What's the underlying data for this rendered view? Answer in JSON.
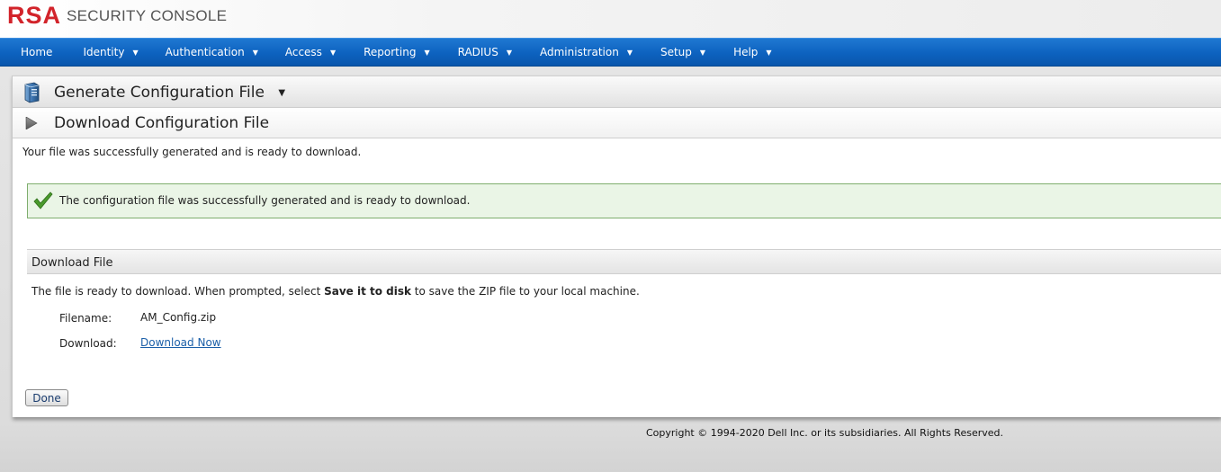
{
  "header": {
    "logo_mark": "RSA",
    "logo_text": "SECURITY CONSOLE"
  },
  "nav": {
    "items": [
      {
        "label": "Home",
        "has_menu": false
      },
      {
        "label": "Identity",
        "has_menu": true
      },
      {
        "label": "Authentication",
        "has_menu": true
      },
      {
        "label": "Access",
        "has_menu": true
      },
      {
        "label": "Reporting",
        "has_menu": true
      },
      {
        "label": "RADIUS",
        "has_menu": true
      },
      {
        "label": "Administration",
        "has_menu": true
      },
      {
        "label": "Setup",
        "has_menu": true
      },
      {
        "label": "Help",
        "has_menu": true
      }
    ],
    "caret": "▼"
  },
  "page": {
    "title": "Generate Configuration File",
    "title_icon": "server-icon",
    "subtitle": "Download Configuration File",
    "subtitle_icon": "play-arrow-icon",
    "intro": "Your file was successfully generated and is ready to download."
  },
  "success_message": {
    "icon": "checkmark-icon",
    "text": "The configuration file was successfully generated and is ready to download."
  },
  "download_section": {
    "title": "Download File",
    "instructions_before": "The file is ready to download. When prompted, select ",
    "instructions_bold": "Save it to disk",
    "instructions_after": " to save the ZIP file to your local machine.",
    "filename_label": "Filename:",
    "filename_value": "AM_Config.zip",
    "download_label": "Download:",
    "download_link": "Download Now"
  },
  "buttons": {
    "done": "Done"
  },
  "footer": {
    "copyright": "Copyright © 1994-2020 Dell Inc. or its subsidiaries. All Rights Reserved."
  },
  "colors": {
    "brand_red": "#d2232a",
    "nav_blue": "#0d62bf",
    "success_border": "#7fae6e",
    "success_bg": "#eaf5e6",
    "link": "#1b5fa8"
  }
}
